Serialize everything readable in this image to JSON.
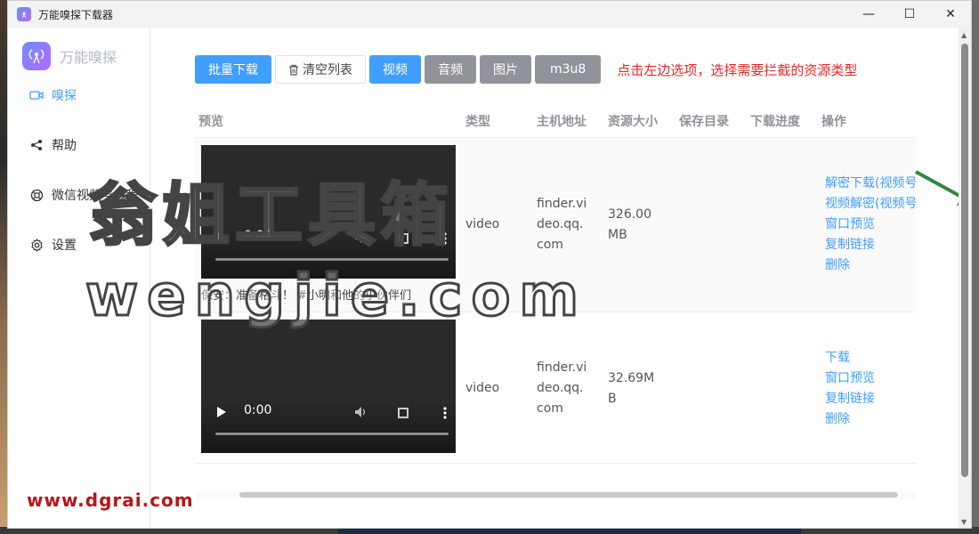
{
  "window": {
    "title": "万能嗅探下载器",
    "controls": {
      "minimize": "—",
      "maximize": "☐",
      "close": "✕"
    }
  },
  "sidebar": {
    "brand": "万能嗅探",
    "items": [
      {
        "label": "嗅探",
        "icon": "video-icon",
        "active": true
      },
      {
        "label": "帮助",
        "icon": "share-icon",
        "active": false
      },
      {
        "label": "微信视频号教程",
        "icon": "lifebuoy-icon",
        "active": false
      },
      {
        "label": "设置",
        "icon": "gear-icon",
        "active": false
      }
    ]
  },
  "toolbar": {
    "batch_download": "批量下载",
    "clear_list": "清空列表",
    "filters": [
      "视频",
      "音频",
      "图片",
      "m3u8"
    ],
    "hint": "点击左边选项，选择需要拦截的资源类型"
  },
  "table": {
    "headers": {
      "preview": "预览",
      "type": "类型",
      "host": "主机地址",
      "size": "资源大小",
      "dir": "保存目录",
      "progress": "下载进度",
      "ops": "操作"
    },
    "rows": [
      {
        "video_time": "0:00",
        "caption": "保安：准备格斗！ #小明和他的小伙伴们",
        "type": "video",
        "host_lines": [
          "finder.vi",
          "deo.qq.",
          "com"
        ],
        "size_lines": [
          "326.00",
          "MB"
        ],
        "ops": [
          "解密下载(视频号",
          "视频解密(视频号",
          "窗口预览",
          "复制链接",
          "删除"
        ]
      },
      {
        "video_time": "0:00",
        "caption": "",
        "type": "video",
        "host_lines": [
          "finder.vi",
          "deo.qq.",
          "com"
        ],
        "size_lines": [
          "32.69M",
          "B"
        ],
        "ops": [
          "下载",
          "窗口预览",
          "复制链接",
          "删除"
        ]
      }
    ]
  },
  "watermarks": {
    "line1": "翁姐工具箱",
    "line2": "wengjie.com",
    "site": "www.dgrai.com"
  },
  "colors": {
    "accent": "#409eff",
    "gray_button": "#909399",
    "hint": "#e62828",
    "arrow": "#2e8b3e"
  }
}
